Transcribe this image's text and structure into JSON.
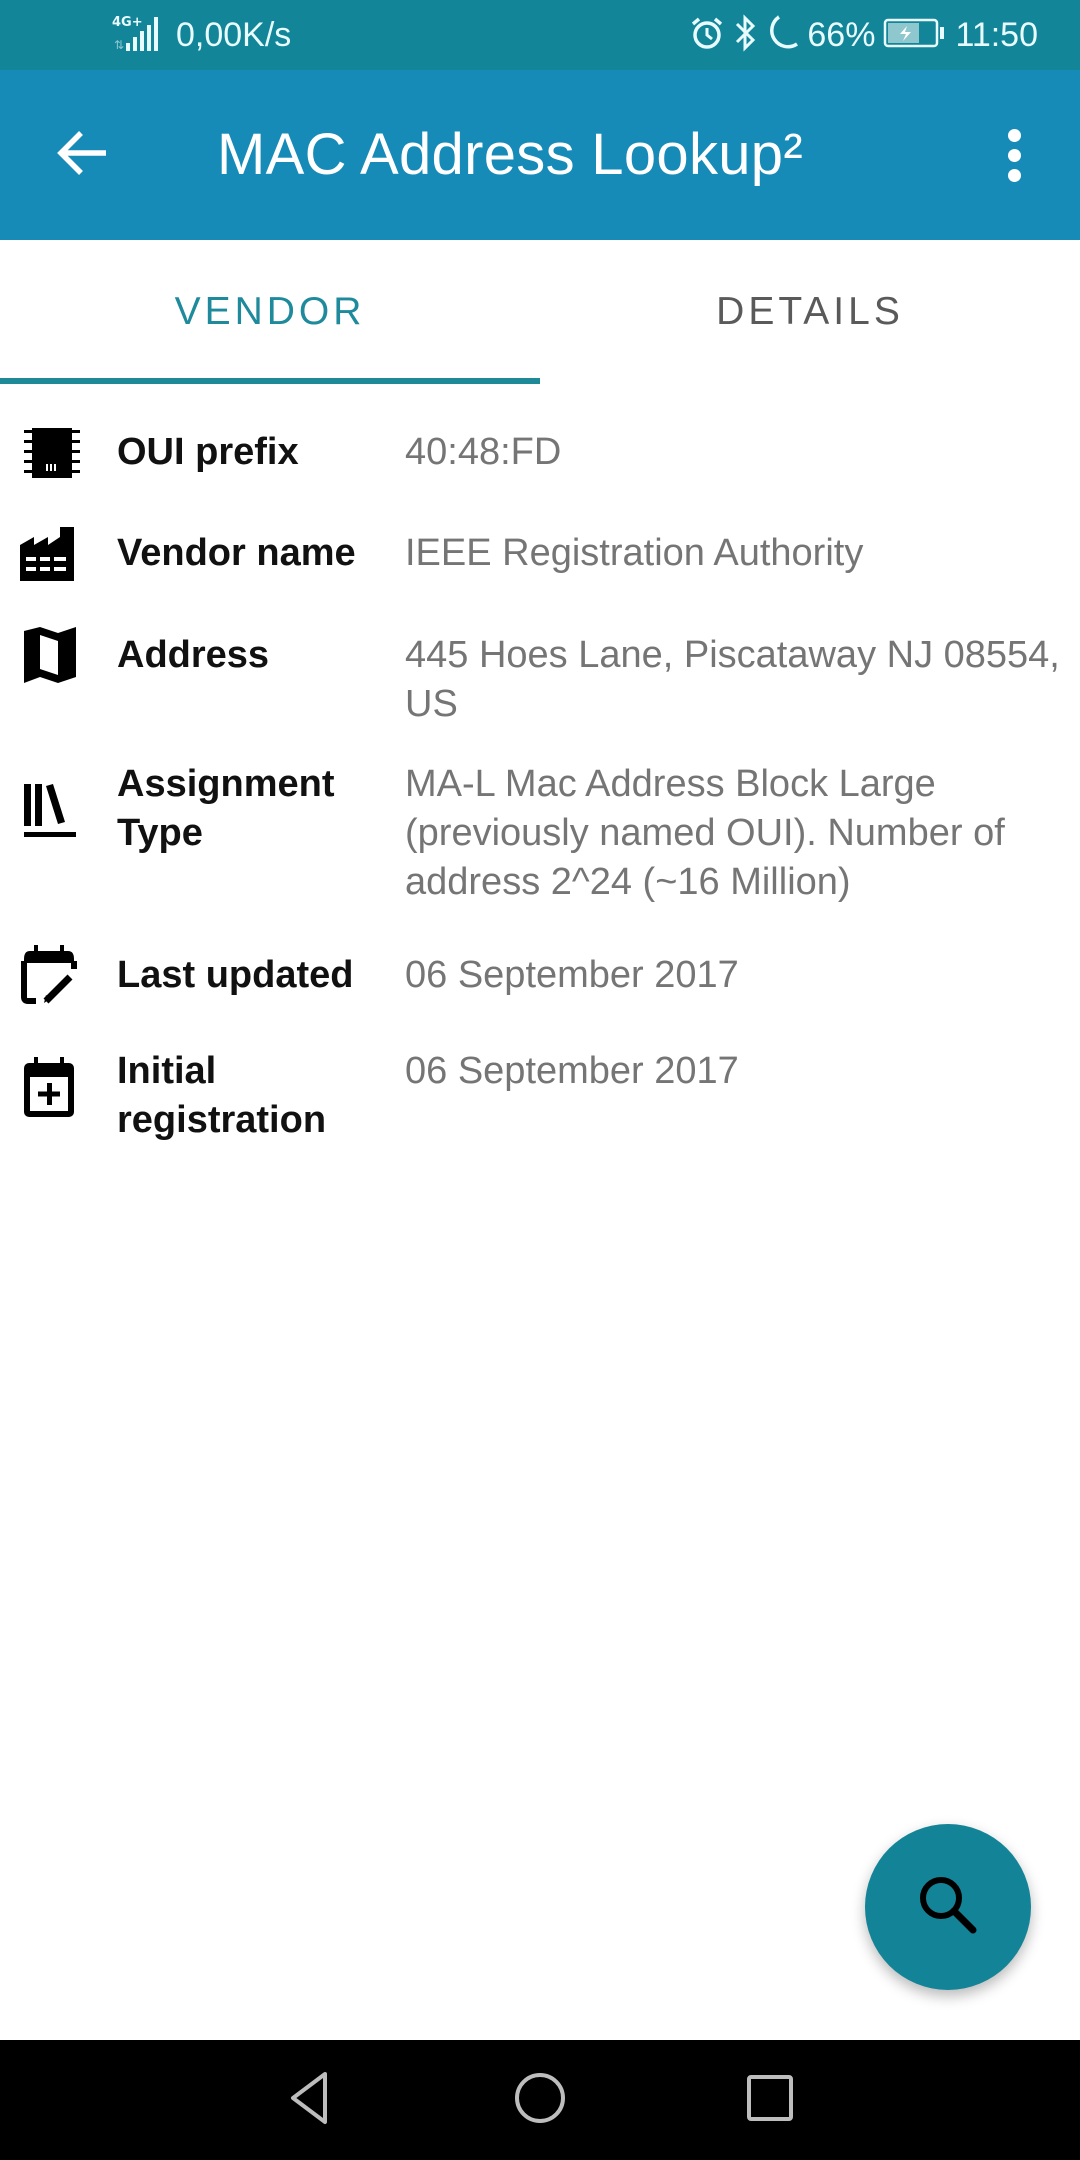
{
  "status_bar": {
    "network_type": "4G+",
    "data_speed": "0,00K/s",
    "battery_percent": "66%",
    "time": "11:50",
    "icons": [
      "signal-icon",
      "alarm-icon",
      "bluetooth-icon",
      "do-not-disturb-moon-icon",
      "battery-charging-icon"
    ]
  },
  "app_bar": {
    "title": "MAC Address Lookup²",
    "back_icon": "arrow-back-icon",
    "menu_icon": "more-vertical-icon"
  },
  "tabs": [
    {
      "label": "VENDOR",
      "active": true
    },
    {
      "label": "DETAILS",
      "active": false
    }
  ],
  "colors": {
    "status_bar": "#138598",
    "app_bar": "#178bb8",
    "accent": "#1e8a9c",
    "fab": "#138397"
  },
  "vendor": {
    "rows": [
      {
        "icon": "chip-icon",
        "label": "OUI prefix",
        "value": "40:48:FD"
      },
      {
        "icon": "factory-icon",
        "label": "Vendor name",
        "value": "IEEE Registration Authority"
      },
      {
        "icon": "map-icon",
        "label": "Address",
        "value": "445 Hoes Lane, Piscataway NJ 08554, US"
      },
      {
        "icon": "library-books-icon",
        "label": "Assignment Type",
        "value": "MA-L Mac Address Block Large (previously named OUI). Number of address 2^24 (~16 Million)"
      },
      {
        "icon": "calendar-edit-icon",
        "label": "Last updated",
        "value": "06 September 2017"
      },
      {
        "icon": "calendar-plus-icon",
        "label": "Initial registration",
        "value": "06 September 2017"
      }
    ]
  },
  "fab": {
    "icon": "search-icon",
    "action": "search"
  },
  "nav_bar": {
    "icons": [
      "nav-back-icon",
      "nav-home-icon",
      "nav-recents-icon"
    ]
  }
}
